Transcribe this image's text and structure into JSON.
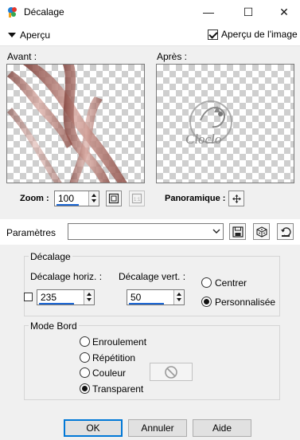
{
  "window": {
    "title": "Décalage",
    "minimize_glyph": "—",
    "maximize_glyph": "☐",
    "close_glyph": "✕"
  },
  "preview_toggle": {
    "label": "Aperçu",
    "image_preview_label": "Aperçu de l'image",
    "image_preview_checked": true
  },
  "before": {
    "label": "Avant :"
  },
  "after": {
    "label": "Après :",
    "watermark_text": "Cloclo"
  },
  "zoom": {
    "label": "Zoom :",
    "value": "100"
  },
  "panoramique": {
    "label": "Panoramique :"
  },
  "params": {
    "label": "Paramètres",
    "preset_value": ""
  },
  "decalage": {
    "title": "Décalage",
    "horiz_label": "Décalage horiz. :",
    "horiz_value": "235",
    "vert_label": "Décalage vert. :",
    "vert_value": "50",
    "centrer_label": "Centrer",
    "perso_label": "Personnalisée",
    "selected": "perso"
  },
  "mode_bord": {
    "title": "Mode Bord",
    "options": [
      "Enroulement",
      "Répétition",
      "Couleur",
      "Transparent"
    ],
    "selected": "Transparent"
  },
  "buttons": {
    "ok": "OK",
    "cancel": "Annuler",
    "help": "Aide"
  },
  "colors": {
    "accent": "#0078d7",
    "ribbon": "#a0645a"
  }
}
